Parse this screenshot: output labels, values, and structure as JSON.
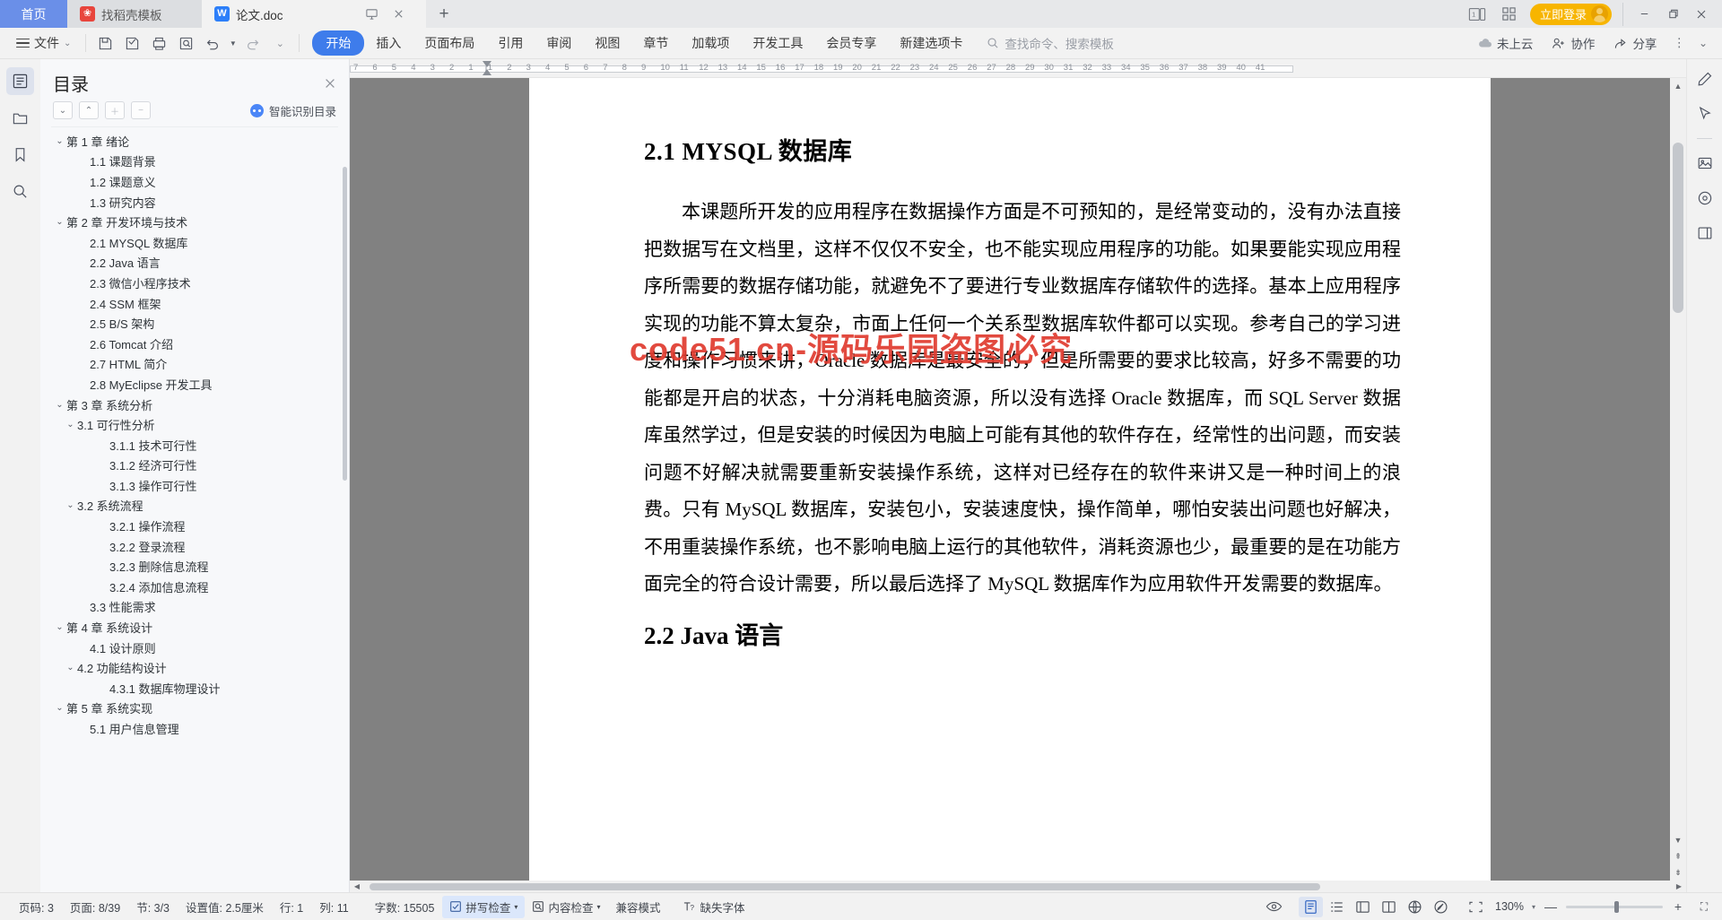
{
  "window": {
    "tabs": [
      {
        "label": "首页",
        "type": "home"
      },
      {
        "label": "找稻壳模板",
        "type": "inactive",
        "icon": "docer-icon"
      },
      {
        "label": "论文.doc",
        "type": "active",
        "icon": "wps-writer-icon"
      }
    ],
    "tab_actions": [
      "present-icon",
      "close-tab-icon"
    ],
    "new_tab": "+",
    "right_icons": [
      "single-page-view-icon",
      "grid-view-icon"
    ],
    "login_label": "立即登录",
    "win_controls": {
      "minimize": "—",
      "restore": "❐",
      "close": "✕"
    }
  },
  "ribbon": {
    "file_menu": "文件",
    "quick_icons": [
      "save-icon",
      "save-as-icon",
      "print-icon",
      "print-preview-icon",
      "undo-icon",
      "redo-icon",
      "customize-icon"
    ],
    "tabs": [
      {
        "label": "开始",
        "selected": true
      },
      {
        "label": "插入",
        "selected": false
      },
      {
        "label": "页面布局",
        "selected": false
      },
      {
        "label": "引用",
        "selected": false
      },
      {
        "label": "审阅",
        "selected": false
      },
      {
        "label": "视图",
        "selected": false
      },
      {
        "label": "章节",
        "selected": false
      },
      {
        "label": "加载项",
        "selected": false
      },
      {
        "label": "开发工具",
        "selected": false
      },
      {
        "label": "会员专享",
        "selected": false
      },
      {
        "label": "新建选项卡",
        "selected": false
      }
    ],
    "search_placeholder": "查找命令、搜索模板",
    "right_buttons": [
      {
        "label": "未上云",
        "icon": "cloud-icon"
      },
      {
        "label": "协作",
        "icon": "collaborate-icon"
      },
      {
        "label": "分享",
        "icon": "share-icon"
      }
    ],
    "more": "⋮",
    "collapse": "⌄"
  },
  "left_rail": [
    {
      "name": "outline-icon",
      "active": true
    },
    {
      "name": "folder-icon",
      "active": false
    },
    {
      "name": "bookmark-icon",
      "active": false
    },
    {
      "name": "search-icon",
      "active": false
    }
  ],
  "toc": {
    "title": "目录",
    "close": "✕",
    "tools": [
      "expand-down-icon",
      "collapse-up-icon",
      "plus-icon",
      "minus-icon"
    ],
    "smart_label": "智能识别目录",
    "items": [
      {
        "label": "第 1 章  绪论",
        "level": 1,
        "carat": "⌄"
      },
      {
        "label": "1.1  课题背景",
        "level": 2,
        "carat": ""
      },
      {
        "label": "1.2  课题意义",
        "level": 2,
        "carat": ""
      },
      {
        "label": "1.3  研究内容",
        "level": 2,
        "carat": ""
      },
      {
        "label": "第 2 章  开发环境与技术",
        "level": 1,
        "carat": "⌄"
      },
      {
        "label": "2.1 MYSQL 数据库",
        "level": 2,
        "carat": ""
      },
      {
        "label": "2.2 Java 语言",
        "level": 2,
        "carat": ""
      },
      {
        "label": "2.3  微信小程序技术",
        "level": 2,
        "carat": ""
      },
      {
        "label": "2.4 SSM 框架",
        "level": 2,
        "carat": ""
      },
      {
        "label": "2.5 B/S 架构",
        "level": 2,
        "carat": ""
      },
      {
        "label": "2.6 Tomcat  介绍",
        "level": 2,
        "carat": ""
      },
      {
        "label": "2.7 HTML 简介",
        "level": 2,
        "carat": ""
      },
      {
        "label": "2.8 MyEclipse 开发工具",
        "level": 2,
        "carat": ""
      },
      {
        "label": "第 3 章  系统分析",
        "level": 1,
        "carat": "⌄"
      },
      {
        "label": "3.1  可行性分析",
        "level": 2,
        "carat": "⌄"
      },
      {
        "label": "3.1.1  技术可行性",
        "level": 3,
        "carat": ""
      },
      {
        "label": "3.1.2  经济可行性",
        "level": 3,
        "carat": ""
      },
      {
        "label": "3.1.3  操作可行性",
        "level": 3,
        "carat": ""
      },
      {
        "label": "3.2  系统流程",
        "level": 2,
        "carat": "⌄"
      },
      {
        "label": "3.2.1  操作流程",
        "level": 3,
        "carat": ""
      },
      {
        "label": "3.2.2  登录流程",
        "level": 3,
        "carat": ""
      },
      {
        "label": "3.2.3  删除信息流程",
        "level": 3,
        "carat": ""
      },
      {
        "label": "3.2.4  添加信息流程",
        "level": 3,
        "carat": ""
      },
      {
        "label": "3.3  性能需求",
        "level": 2,
        "carat": ""
      },
      {
        "label": "第 4 章  系统设计",
        "level": 1,
        "carat": "⌄"
      },
      {
        "label": "4.1  设计原则",
        "level": 2,
        "carat": ""
      },
      {
        "label": "4.2  功能结构设计",
        "level": 2,
        "carat": "⌄"
      },
      {
        "label": "4.3.1  数据库物理设计",
        "level": 3,
        "carat": ""
      },
      {
        "label": "第 5 章  系统实现",
        "level": 1,
        "carat": "⌄"
      },
      {
        "label": "5.1 用户信息管理",
        "level": 2,
        "carat": ""
      }
    ]
  },
  "ruler": {
    "ticks": [
      "7",
      "6",
      "5",
      "4",
      "3",
      "2",
      "1",
      "1",
      "2",
      "3",
      "4",
      "5",
      "6",
      "7",
      "8",
      "9",
      "10",
      "11",
      "12",
      "13",
      "14",
      "15",
      "16",
      "17",
      "18",
      "19",
      "20",
      "21",
      "22",
      "23",
      "24",
      "25",
      "26",
      "27",
      "28",
      "29",
      "30",
      "31",
      "32",
      "33",
      "34",
      "35",
      "36",
      "37",
      "38",
      "39",
      "40",
      "41"
    ]
  },
  "document": {
    "heading": "2.1 MYSQL 数据库",
    "paragraph": "本课题所开发的应用程序在数据操作方面是不可预知的，是经常变动的，没有办法直接把数据写在文档里，这样不仅仅不安全，也不能实现应用程序的功能。如果要能实现应用程序所需要的数据存储功能，就避免不了要进行专业数据库存储软件的选择。基本上应用程序实现的功能不算太复杂，市面上任何一个关系型数据库软件都可以实现。参考自己的学习进度和操作习惯来讲，Oracle 数据库是最安全的，但是所需要的要求比较高，好多不需要的功能都是开启的状态，十分消耗电脑资源，所以没有选择 Oracle 数据库，而 SQL Server 数据库虽然学过，但是安装的时候因为电脑上可能有其他的软件存在，经常性的出问题，而安装问题不好解决就需要重新安装操作系统，这样对已经存在的软件来讲又是一种时间上的浪费。只有 MySQL 数据库，安装包小，安装速度快，操作简单，哪怕安装出问题也好解决，不用重装操作系统，也不影响电脑上运行的其他软件，消耗资源也少，最重要的是在功能方面完全的符合设计需要，所以最后选择了 MySQL 数据库作为应用软件开发需要的数据库。",
    "heading2": "2.2 Java 语言",
    "watermark": "code51.cn-源码乐园盗图必究"
  },
  "right_rail": [
    {
      "name": "edit-pen-icon"
    },
    {
      "name": "cursor-select-icon"
    },
    {
      "name": "separator"
    },
    {
      "name": "image-insert-icon"
    },
    {
      "name": "location-icon"
    },
    {
      "name": "panel-layout-icon"
    }
  ],
  "status": {
    "page_no": "页码: 3",
    "pages": "页面: 8/39",
    "section": "节: 3/3",
    "setting": "设置值: 2.5厘米",
    "line": "行: 1",
    "column": "列: 11",
    "words": "字数: 15505",
    "spell_check": "拼写检查",
    "content_check": "内容检查",
    "compat_mode": "兼容模式",
    "missing_font": "缺失字体",
    "view_buttons": [
      "eye-icon",
      "page-view-icon",
      "outline-view-icon",
      "web-view-icon",
      "reading-view-icon",
      "globe-icon",
      "pen-mark-icon"
    ],
    "fit_icon": "fit-page-icon",
    "zoom": "130%",
    "zoom_out": "—",
    "zoom_in": "+",
    "fullscreen": "⛶"
  }
}
